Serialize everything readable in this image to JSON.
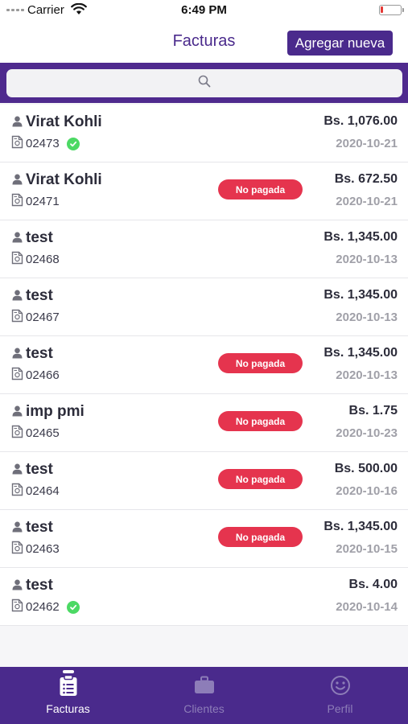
{
  "status_bar": {
    "carrier": "Carrier",
    "time": "6:49 PM"
  },
  "header": {
    "title": "Facturas",
    "add_button": "Agregar nueva"
  },
  "search": {
    "placeholder": "",
    "icon": "search-icon"
  },
  "invoices": [
    {
      "client": "Virat Kohli",
      "number": "02473",
      "paid": true,
      "status_label": "",
      "amount": "Bs. 1,076.00",
      "date": "2020-10-21"
    },
    {
      "client": "Virat Kohli",
      "number": "02471",
      "paid": false,
      "status_label": "No pagada",
      "amount": "Bs. 672.50",
      "date": "2020-10-21"
    },
    {
      "client": "test",
      "number": "02468",
      "paid": null,
      "status_label": "",
      "amount": "Bs. 1,345.00",
      "date": "2020-10-13"
    },
    {
      "client": "test",
      "number": "02467",
      "paid": null,
      "status_label": "",
      "amount": "Bs. 1,345.00",
      "date": "2020-10-13"
    },
    {
      "client": "test",
      "number": "02466",
      "paid": false,
      "status_label": "No pagada",
      "amount": "Bs. 1,345.00",
      "date": "2020-10-13"
    },
    {
      "client": "imp pmi",
      "number": "02465",
      "paid": false,
      "status_label": "No pagada",
      "amount": "Bs. 1.75",
      "date": "2020-10-23"
    },
    {
      "client": "test",
      "number": "02464",
      "paid": false,
      "status_label": "No pagada",
      "amount": "Bs. 500.00",
      "date": "2020-10-16"
    },
    {
      "client": "test",
      "number": "02463",
      "paid": false,
      "status_label": "No pagada",
      "amount": "Bs. 1,345.00",
      "date": "2020-10-15"
    },
    {
      "client": "test",
      "number": "02462",
      "paid": true,
      "status_label": "",
      "amount": "Bs. 4.00",
      "date": "2020-10-14"
    }
  ],
  "tabs": [
    {
      "label": "Facturas",
      "icon": "clipboard-icon",
      "active": true
    },
    {
      "label": "Clientes",
      "icon": "briefcase-icon",
      "active": false
    },
    {
      "label": "Perfil",
      "icon": "smiley-icon",
      "active": false
    }
  ],
  "colors": {
    "primary": "#4a2a8c",
    "unpaid": "#e5344e",
    "paid": "#4cd964"
  }
}
